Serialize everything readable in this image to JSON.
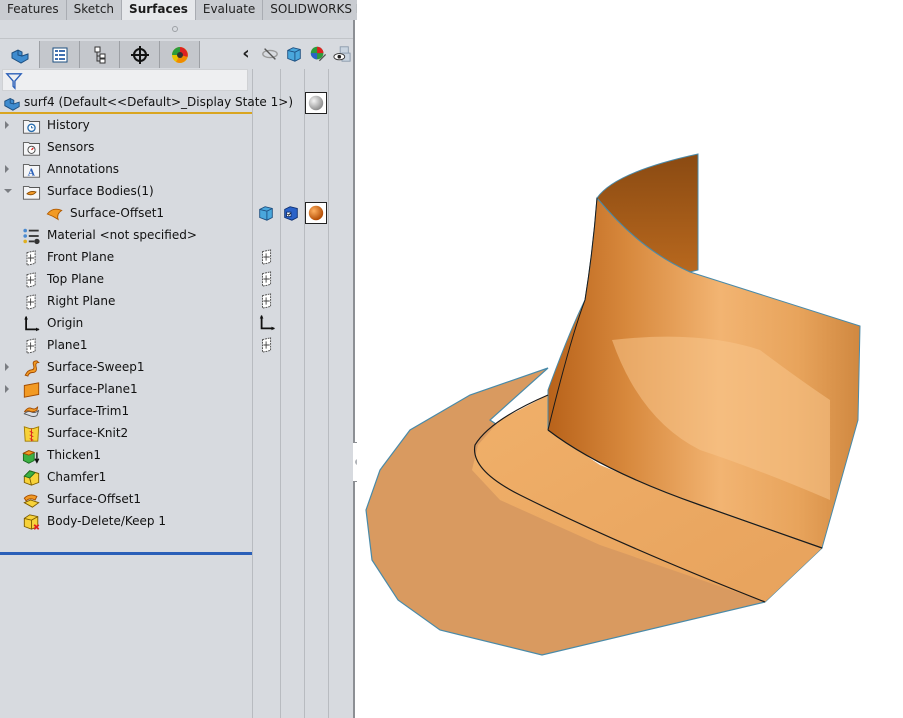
{
  "command_tabs": [
    {
      "label": "Features",
      "active": false
    },
    {
      "label": "Sketch",
      "active": false
    },
    {
      "label": "Surfaces",
      "active": true
    },
    {
      "label": "Evaluate",
      "active": false
    },
    {
      "label": "SOLIDWORKS MBD",
      "active": false
    }
  ],
  "manager_tabs": [
    {
      "name": "featuremanager-tab",
      "icon": "part-icon"
    },
    {
      "name": "propertymanager-tab",
      "icon": "property-list-icon"
    },
    {
      "name": "configurationmanager-tab",
      "icon": "configuration-tree-icon"
    },
    {
      "name": "dimxpertmanager-tab",
      "icon": "crosshair-icon"
    },
    {
      "name": "displaymanager-tab",
      "icon": "color-wheel-icon"
    }
  ],
  "panel_tools": {
    "collapse": "‹",
    "icons": [
      "hide-show-icon",
      "display-style-cube-icon",
      "appearance-edit-icon",
      "view-settings-icon"
    ]
  },
  "root": {
    "label": "surf4  (Default<<Default>_Display State 1>)"
  },
  "tree": [
    {
      "label": "History",
      "icon": "history-folder-icon",
      "expander": "closed"
    },
    {
      "label": "Sensors",
      "icon": "sensors-folder-icon",
      "expander": "none"
    },
    {
      "label": "Annotations",
      "icon": "annotations-folder-icon",
      "expander": "closed"
    },
    {
      "label": "Surface Bodies(1)",
      "icon": "surface-bodies-folder-icon",
      "expander": "open"
    },
    {
      "label": "Surface-Offset1",
      "icon": "surface-body-icon",
      "expander": "none",
      "indent": true
    },
    {
      "label": "Material <not specified>",
      "icon": "material-icon",
      "expander": "none"
    },
    {
      "label": "Front Plane",
      "icon": "plane-icon",
      "expander": "none"
    },
    {
      "label": "Top Plane",
      "icon": "plane-icon",
      "expander": "none"
    },
    {
      "label": "Right Plane",
      "icon": "plane-icon",
      "expander": "none"
    },
    {
      "label": "Origin",
      "icon": "origin-icon",
      "expander": "none"
    },
    {
      "label": "Plane1",
      "icon": "plane-icon",
      "expander": "none"
    },
    {
      "label": "Surface-Sweep1",
      "icon": "surface-sweep-icon",
      "expander": "closed"
    },
    {
      "label": "Surface-Plane1",
      "icon": "surface-plane-icon",
      "expander": "closed"
    },
    {
      "label": "Surface-Trim1",
      "icon": "surface-trim-icon",
      "expander": "none"
    },
    {
      "label": "Surface-Knit2",
      "icon": "surface-knit-icon",
      "expander": "none"
    },
    {
      "label": "Thicken1",
      "icon": "thicken-icon",
      "expander": "none"
    },
    {
      "label": "Chamfer1",
      "icon": "chamfer-icon",
      "expander": "none"
    },
    {
      "label": "Surface-Offset1",
      "icon": "surface-offset-icon",
      "expander": "none"
    },
    {
      "label": "Body-Delete/Keep 1",
      "icon": "body-delete-keep-icon",
      "expander": "none"
    }
  ],
  "colors": {
    "accent_rollback": "#2a5fb8",
    "root_underline": "#d9a520",
    "model_orange": "#d89a5f",
    "model_edge": "#4a8aa8"
  }
}
